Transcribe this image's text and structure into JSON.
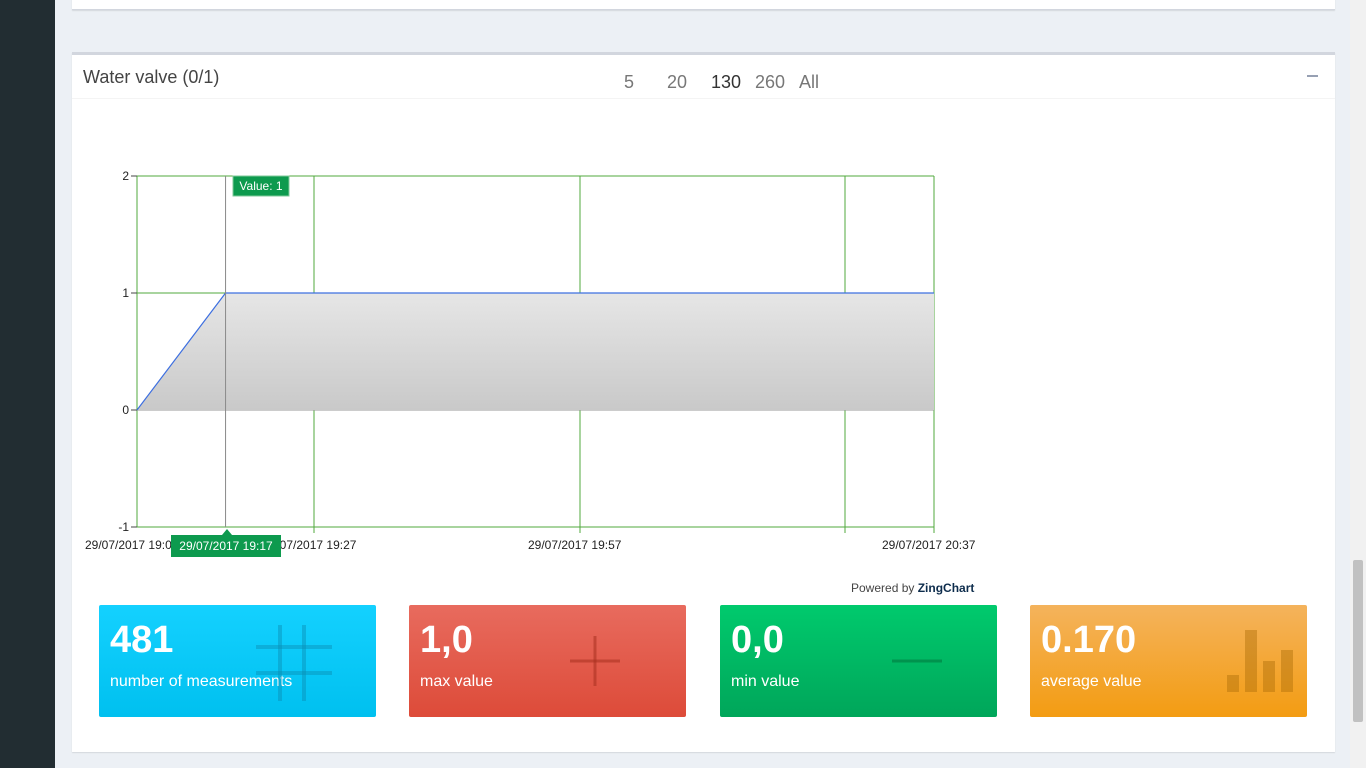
{
  "panel": {
    "title": "Water valve (0/1)"
  },
  "ranges": [
    {
      "label": "5",
      "active": false
    },
    {
      "label": "20",
      "active": false
    },
    {
      "label": "130",
      "active": true
    },
    {
      "label": "260",
      "active": false
    },
    {
      "label": "All",
      "active": false
    }
  ],
  "chart_data": {
    "type": "area",
    "xlabel": "",
    "ylabel": "",
    "ylim": [
      -1,
      2
    ],
    "y_ticks": [
      "2",
      "1",
      "0",
      "-1"
    ],
    "x_tick_labels": [
      "29/07/2017 19:07",
      "29/07/2017 19:27",
      "29/07/2017 19:57",
      "29/07/2017 20:37"
    ],
    "series": [
      {
        "x": [
          "29/07/2017 19:07",
          "29/07/2017 19:17",
          "29/07/2017 20:37"
        ],
        "values": [
          0,
          1,
          1
        ]
      }
    ],
    "tooltip": {
      "value_label": "Value: 1",
      "x_label": "29/07/2017 19:17"
    },
    "grid": true,
    "colors": {
      "line": "#3d6fe0",
      "grid": "#52a83d",
      "tooltip": "#0d9a4e"
    }
  },
  "powered": {
    "prefix": "Powered by ",
    "brand": "ZingChart"
  },
  "tiles": [
    {
      "value": "481",
      "label": "number of measurements",
      "icon": "grid-icon",
      "color": "#00c0ef"
    },
    {
      "value": "1,0",
      "label": "max value",
      "icon": "plus-icon",
      "color": "#dd4b39"
    },
    {
      "value": "0,0",
      "label": "min value",
      "icon": "minus-icon",
      "color": "#00a65a"
    },
    {
      "value": "0.170",
      "label": "average value",
      "icon": "bar-chart-icon",
      "color": "#f39c12"
    }
  ]
}
